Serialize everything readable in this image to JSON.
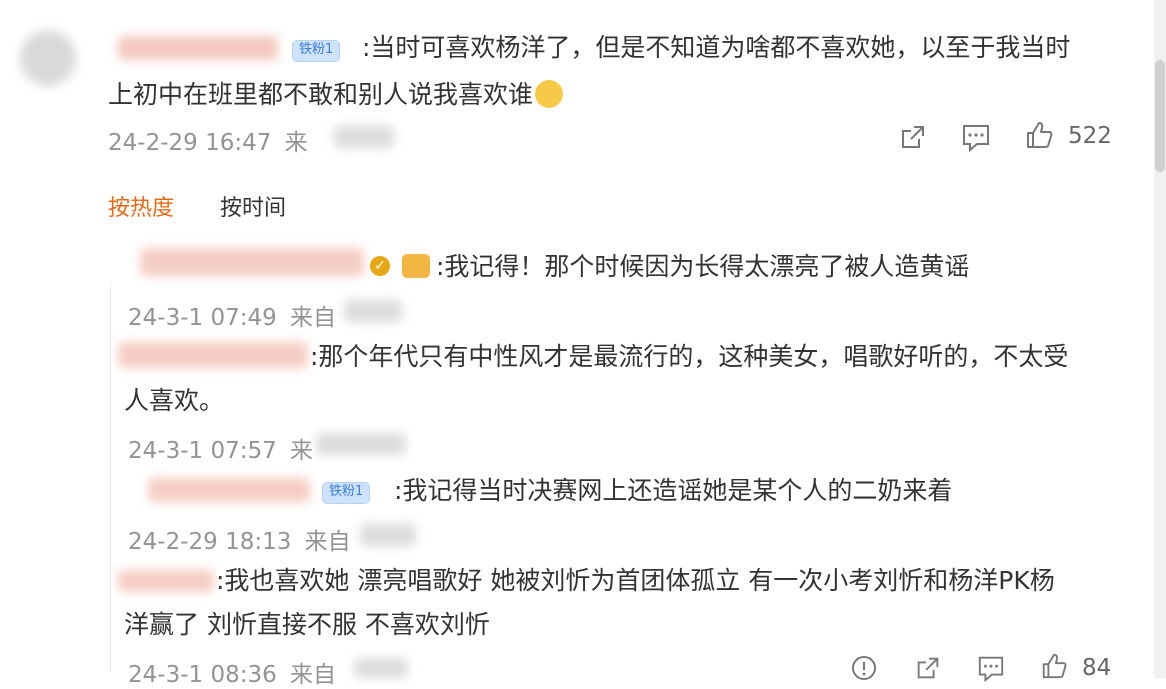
{
  "main_comment": {
    "badge": "铁粉1",
    "line1": ":当时可喜欢杨洋了，但是不知道为啥都不喜欢她，以至于我当时",
    "line2": "上初中在班里都不敢和别人说我喜欢谁",
    "time": "24-2-29 16:47",
    "source_prefix": "来",
    "like_count": "522"
  },
  "sort_tabs": {
    "hot": "按热度",
    "time": "按时间"
  },
  "replies": [
    {
      "text": ":我记得！那个时候因为长得太漂亮了被人造黄谣",
      "time": "24-3-1 07:49",
      "source_prefix": "来自"
    },
    {
      "text_line1": ":那个年代只有中性风才是最流行的，这种美女，唱歌好听的，不太受",
      "text_line2": "人喜欢。",
      "time": "24-3-1 07:57",
      "source_prefix": "来"
    },
    {
      "badge": "铁粉1",
      "text": ":我记得当时决赛网上还造谣她是某个人的二奶来着",
      "time": "24-2-29 18:13",
      "source_prefix": "来自"
    },
    {
      "text_line1": ":我也喜欢她 漂亮唱歌好 她被刘忻为首团体孤立 有一次小考刘忻和杨洋PK杨",
      "text_line2": "洋赢了 刘忻直接不服 不喜欢刘忻",
      "time": "24-3-1 08:36",
      "source_prefix": "来自",
      "like_count": "84"
    }
  ],
  "colors": {
    "accent_orange": "#e86a17",
    "meta_gray": "#939393",
    "text": "#333333"
  }
}
